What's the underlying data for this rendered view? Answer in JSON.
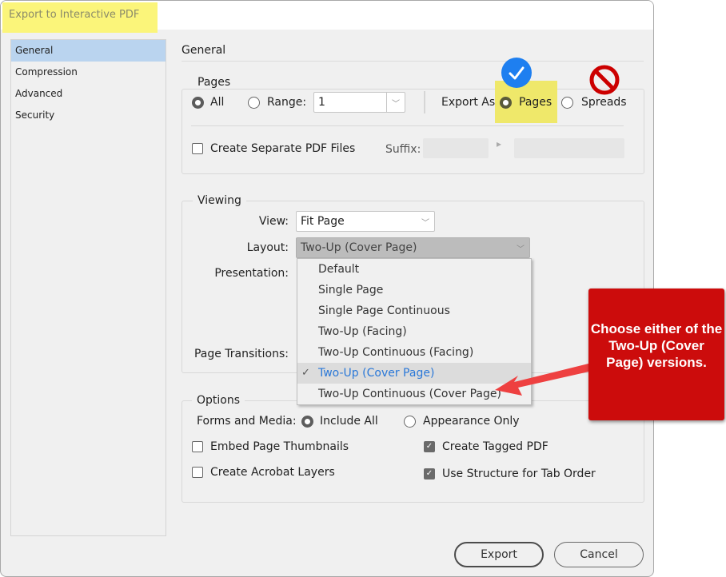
{
  "window": {
    "title": "Export to Interactive PDF"
  },
  "sidebar": {
    "items": [
      {
        "label": "General",
        "active": true
      },
      {
        "label": "Compression",
        "active": false
      },
      {
        "label": "Advanced",
        "active": false
      },
      {
        "label": "Security",
        "active": false
      }
    ]
  },
  "main": {
    "section_title": "General",
    "pages": {
      "group_label": "Pages",
      "all_label": "All",
      "all_selected": true,
      "range_label": "Range:",
      "range_value": "1",
      "export_as_label": "Export As",
      "pages_option": "Pages",
      "pages_selected": true,
      "spreads_option": "Spreads",
      "create_separate_label": "Create Separate PDF Files",
      "create_separate_checked": false,
      "suffix_label": "Suffix:"
    },
    "viewing": {
      "group_label": "Viewing",
      "view_label": "View:",
      "view_value": "Fit Page",
      "layout_label": "Layout:",
      "layout_value": "Two-Up (Cover Page)",
      "presentation_label": "Presentation:",
      "page_transitions_label": "Page Transitions:",
      "layout_options": [
        {
          "label": "Default",
          "selected": false
        },
        {
          "label": "Single Page",
          "selected": false
        },
        {
          "label": "Single Page Continuous",
          "selected": false
        },
        {
          "label": "Two-Up (Facing)",
          "selected": false
        },
        {
          "label": "Two-Up Continuous (Facing)",
          "selected": false
        },
        {
          "label": "Two-Up (Cover Page)",
          "selected": true
        },
        {
          "label": "Two-Up Continuous (Cover Page)",
          "selected": false
        }
      ]
    },
    "options": {
      "group_label": "Options",
      "forms_media_label": "Forms and Media:",
      "include_all_label": "Include All",
      "include_all_selected": true,
      "appearance_only_label": "Appearance Only",
      "embed_thumbnails_label": "Embed Page Thumbnails",
      "embed_thumbnails_checked": false,
      "create_tagged_label": "Create Tagged PDF",
      "create_tagged_checked": true,
      "acrobat_layers_label": "Create Acrobat Layers",
      "acrobat_layers_checked": false,
      "tab_order_label": "Use Structure for Tab Order",
      "tab_order_checked": true
    }
  },
  "buttons": {
    "export": "Export",
    "cancel": "Cancel"
  },
  "annotations": {
    "callout_text": "Choose either of the  Two-Up (Cover Page) versions.",
    "callout_color": "#cc0c0c",
    "checkmark_badge_color": "#1e7ff0",
    "prohibited_sign_color": "#cc0000",
    "highlight_color": "#f5ef6a"
  },
  "icons": {
    "checkmark_symbol": "✓",
    "chevron_symbol": "﹀",
    "arrow_right_symbol": "▸"
  }
}
